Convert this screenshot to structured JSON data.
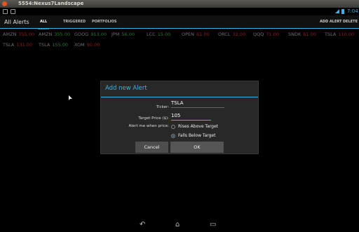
{
  "window": {
    "title": "5554:Nexus7Landscape"
  },
  "status": {
    "time": "7:04"
  },
  "app": {
    "title": "All Alerts",
    "tabs": [
      "ALL",
      "TRIGGERED",
      "PORTFOLIOS"
    ],
    "actions": {
      "add": "ADD ALERT",
      "delete": "DELETE"
    }
  },
  "tickers": [
    {
      "symbol": "AMZN",
      "value": "355.00",
      "trend": "down"
    },
    {
      "symbol": "AMZN",
      "value": "355.00",
      "trend": "up"
    },
    {
      "symbol": "GOOG",
      "value": "913.00",
      "trend": "up"
    },
    {
      "symbol": "JPM",
      "value": "56.00",
      "trend": "up"
    },
    {
      "symbol": "LCC",
      "value": "15.00",
      "trend": "up"
    },
    {
      "symbol": "OPEN",
      "value": "61.00",
      "trend": "down"
    },
    {
      "symbol": "ORCL",
      "value": "32.00",
      "trend": "down"
    },
    {
      "symbol": "QQQ",
      "value": "71.00",
      "trend": "down"
    },
    {
      "symbol": "SNDK",
      "value": "61.00",
      "trend": "down"
    },
    {
      "symbol": "TSLA",
      "value": "110.00",
      "trend": "down"
    },
    {
      "symbol": "TSLA",
      "value": "131.00",
      "trend": "down"
    },
    {
      "symbol": "TSLA",
      "value": "155.00",
      "trend": "up"
    },
    {
      "symbol": "XOM",
      "value": "90.00",
      "trend": "down"
    }
  ],
  "dialog": {
    "title": "Add new Alert",
    "ticker_label": "Ticker:",
    "ticker_value": "TSLA",
    "target_label": "Target Price ($):",
    "target_value": "105",
    "when_label": "Alert me when price:",
    "option_rises": "Rises Above Target",
    "option_falls": "Falls Below Target",
    "selected_option": "falls",
    "cancel_label": "Cancel",
    "ok_label": "OK"
  },
  "colors": {
    "accent": "#33b5e5",
    "up": "#3bb54a",
    "down": "#d32f2f"
  },
  "nav": {
    "icons": [
      "back-icon",
      "home-icon",
      "recent-apps-icon"
    ]
  }
}
